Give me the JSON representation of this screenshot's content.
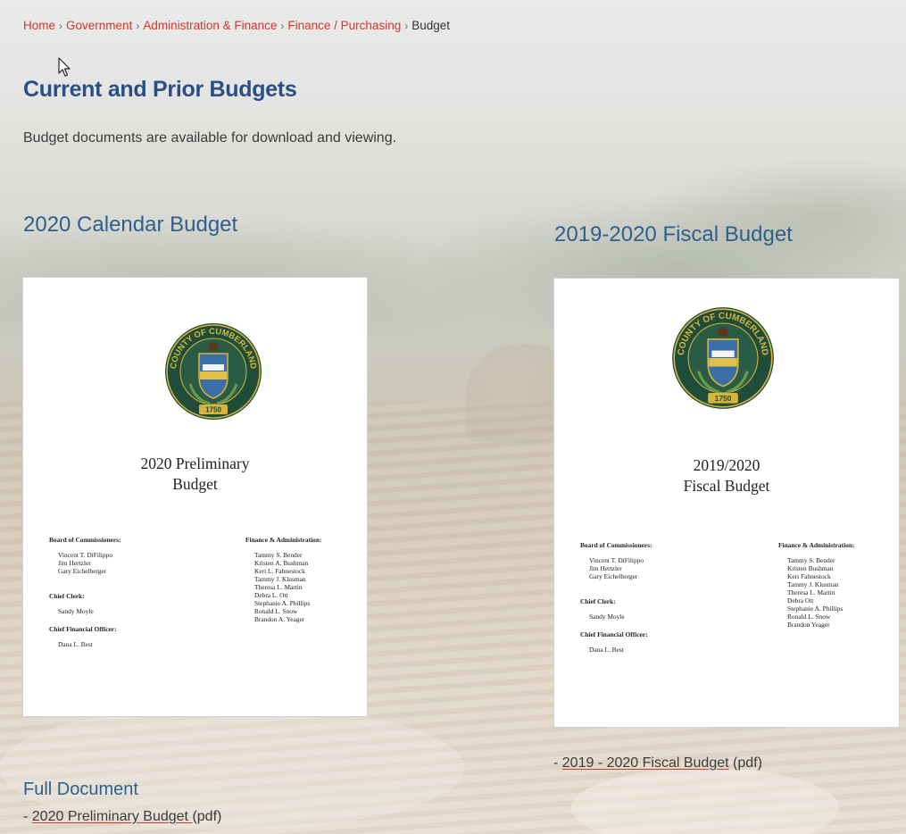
{
  "breadcrumb": {
    "items": [
      "Home",
      "Government",
      "Administration & Finance",
      "Finance / Purchasing"
    ],
    "separator": "›",
    "current": "Budget"
  },
  "page": {
    "title": "Current and Prior Budgets",
    "intro": "Budget documents are available for download and viewing."
  },
  "colors": {
    "link_red": "#d9342b",
    "heading_blue": "#2a4f86",
    "section_blue": "#2f5f8c",
    "seal_green": "#1f4d3a",
    "seal_gold": "#d8b43a"
  },
  "sections": {
    "calendar": {
      "title": "2020 Calendar Budget",
      "document": {
        "seal_text": "COUNTY OF CUMBERLAND",
        "seal_year": "1750",
        "title_line1": "2020 Preliminary",
        "title_line2": "Budget",
        "board_header": "Board of Commissioners:",
        "board": [
          "Vincent T. DiFilippo",
          "Jim Hertzler",
          "Gary Eichelberger"
        ],
        "clerk_header": "Chief Clerk:",
        "clerk": "Sandy Moyle",
        "cfo_header": "Chief Financial Officer:",
        "cfo": "Dana L. Best",
        "finance_header": "Finance & Administration:",
        "finance": [
          "Tammy S. Bender",
          "Kristen A. Bushman",
          "Keri L. Fahnestock",
          "Tammy J. Klusman",
          "Theresa L. Martin",
          "Debra L. Ott",
          "Stephanie A. Phillips",
          "Ronald L. Snow",
          "Brandon A. Yeager"
        ]
      },
      "subheading": "Full Document",
      "link_prefix": "- ",
      "link_text": "2020 Preliminary Budget ",
      "link_suffix": "(pdf)"
    },
    "fiscal": {
      "title": "2019-2020 Fiscal Budget",
      "document": {
        "seal_text": "COUNTY OF CUMBERLAND",
        "seal_year": "1750",
        "title_line1": "2019/2020",
        "title_line2": "Fiscal Budget",
        "board_header": "Board of Commissioners:",
        "board": [
          "Vincent T. DiFilippo",
          "Jim Hertzler",
          "Gary Eichelberger"
        ],
        "clerk_header": "Chief Clerk:",
        "clerk": "Sandy Moyle",
        "cfo_header": "Chief Financial Officer:",
        "cfo": "Dana L. Best",
        "finance_header": "Finance & Administration:",
        "finance": [
          "Tammy S. Bender",
          "Kristen Bushman",
          "Keri Fahnestock",
          "Tammy J. Klusman",
          "Theresa L. Martin",
          "Debra Ott",
          "Stephanie A. Phillips",
          "Ronald L. Snow",
          "Brandon Yeager"
        ]
      },
      "link_prefix": "- ",
      "link_text": "2019 - 2020 Fiscal Budget",
      "link_suffix": " (pdf)"
    }
  },
  "icons": {
    "cursor": "arrow-cursor-icon",
    "seal": "county-seal-icon"
  }
}
